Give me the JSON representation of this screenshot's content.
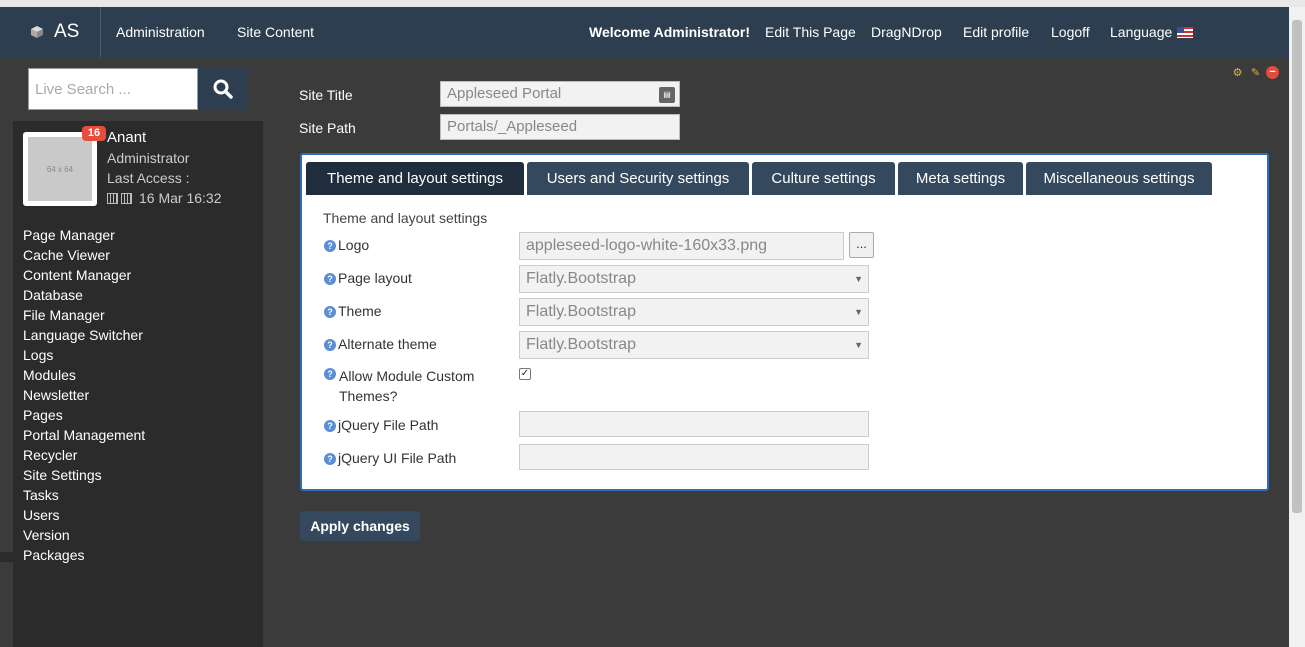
{
  "brand": {
    "text": "AS",
    "icon": "cube-icon"
  },
  "nav": {
    "left": [
      "Administration",
      "Site Content"
    ],
    "welcome": "Welcome Administrator!",
    "right": [
      "Edit This Page",
      "DragNDrop",
      "Edit profile",
      "Logoff",
      "Language"
    ],
    "language_flag": "us-flag-icon"
  },
  "search": {
    "placeholder": "Live Search ..."
  },
  "user": {
    "badge": "16",
    "avatar_text": "64 x 64",
    "name": "Anant",
    "role": "Administrator",
    "last_access_label": "Last Access :",
    "last_access_value": "16 Mar 16:32"
  },
  "menu": [
    "Page Manager",
    "Cache Viewer",
    "Content Manager",
    "Database",
    "File Manager",
    "Language Switcher",
    "Logs",
    "Modules",
    "Newsletter",
    "Pages",
    "Portal Management",
    "Recycler",
    "Site Settings",
    "Tasks",
    "Users",
    "Version",
    "Packages"
  ],
  "site": {
    "title_label": "Site Title",
    "title_value": "Appleseed Portal",
    "path_label": "Site Path",
    "path_value": "Portals/_Appleseed"
  },
  "tabs": [
    "Theme and layout settings",
    "Users and Security settings",
    "Culture settings",
    "Meta settings",
    "Miscellaneous settings"
  ],
  "active_tab": 0,
  "panel": {
    "section_title": "Theme and layout settings",
    "logo_label": "Logo",
    "logo_value": "appleseed-logo-white-160x33.png",
    "browse_label": "...",
    "page_layout_label": "Page layout",
    "page_layout_value": "Flatly.Bootstrap",
    "theme_label": "Theme",
    "theme_value": "Flatly.Bootstrap",
    "alt_theme_label": "Alternate theme",
    "alt_theme_value": "Flatly.Bootstrap",
    "custom_themes_label": "Allow Module Custom Themes?",
    "custom_themes_checked": true,
    "jquery_label": "jQuery File Path",
    "jquery_value": "",
    "jquery_ui_label": "jQuery UI File Path",
    "jquery_ui_value": ""
  },
  "apply_label": "Apply changes",
  "colors": {
    "navbar": "#2c3e50",
    "sidebar": "#2b2b2b",
    "body": "#3b3b3b",
    "panel_border": "#2c6fb5",
    "badge": "#e74c3c"
  }
}
